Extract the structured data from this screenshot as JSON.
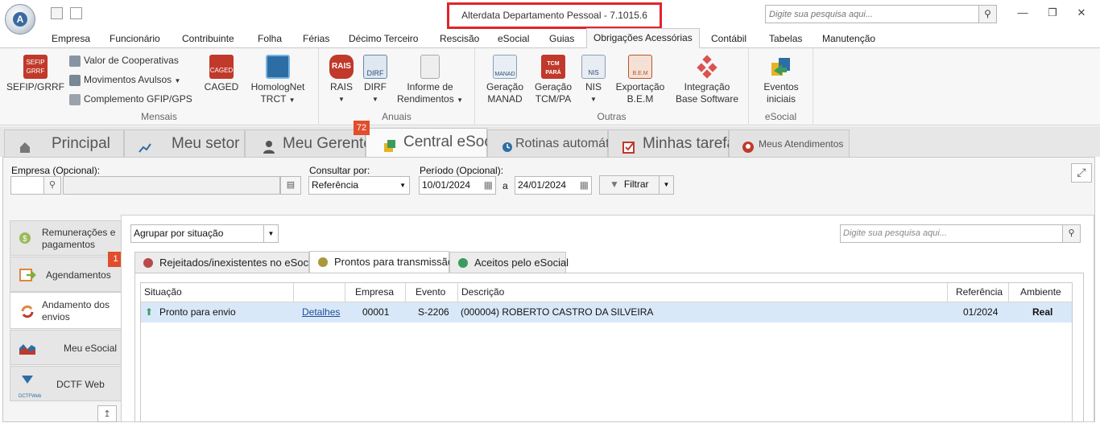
{
  "window": {
    "title": "Alterdata Departamento Pessoal - 7.1015.6",
    "search_placeholder": "Digite sua pesquisa aqui...",
    "app_letter": "A"
  },
  "menu": {
    "items": [
      "Empresa",
      "Funcionário",
      "Contribuinte",
      "Folha",
      "Férias",
      "Décimo Terceiro",
      "Rescisão",
      "eSocial",
      "Guias",
      "Obrigações Acessórias",
      "Contábil",
      "Tabelas",
      "Manutenção"
    ],
    "active": "Obrigações Acessórias"
  },
  "ribbon": {
    "mensais": {
      "label": "Mensais",
      "sefip": "SEFIP/GRRF",
      "sefip_icon_text": "SEFIP GRRF",
      "valor_coop": "Valor de Cooperativas",
      "mov_avulsos": "Movimentos Avulsos",
      "complemento": "Complemento GFIP/GPS",
      "caged": "CAGED",
      "caged_icon_text": "CAGED",
      "homolognet_line1": "HomologNet",
      "homolognet_line2": "TRCT"
    },
    "anuais": {
      "label": "Anuais",
      "rais": "RAIS",
      "rais_icon_text": "RAIS",
      "dirf": "DIRF",
      "dirf_icon_text": "DIRF",
      "informe_line1": "Informe de",
      "informe_line2": "Rendimentos"
    },
    "outras": {
      "label": "Outras",
      "manad_line1": "Geração",
      "manad_line2": "MANAD",
      "manad_icon_text": "MANAD",
      "tcm_line1": "Geração",
      "tcm_line2": "TCM/PA",
      "tcm_icon_text": "TCM PARÁ",
      "nis": "NIS",
      "nis_icon_text": "NIS",
      "bem_line1": "Exportação",
      "bem_line2": "B.E.M",
      "bem_icon_text": "B.E.M",
      "integracao_line1": "Integração",
      "integracao_line2": "Base Software"
    },
    "esocial": {
      "label": "eSocial",
      "eventos_line1": "Eventos",
      "eventos_line2": "iniciais"
    }
  },
  "tabs": [
    {
      "label": "Principal",
      "icon": "home-icon"
    },
    {
      "label": "Meu setor",
      "icon": "chart-icon"
    },
    {
      "label": "Meu Gerente",
      "icon": "person-icon"
    },
    {
      "label": "Central eSocial",
      "icon": "esocial-icon"
    },
    {
      "label": "Rotinas automáticas",
      "icon": "clock-icon"
    },
    {
      "label": "Minhas tarefas",
      "icon": "checkbox-icon"
    },
    {
      "label": "Meus Atendimentos",
      "icon": "support-icon"
    }
  ],
  "tab_badge": "72",
  "filters": {
    "empresa_label": "Empresa (Opcional):",
    "consultar_label": "Consultar por:",
    "consultar_value": "Referência",
    "periodo_label": "Período (Opcional):",
    "date_from": "10/01/2024",
    "date_sep": "a",
    "date_to": "24/01/2024",
    "filtrar": "Filtrar"
  },
  "left_nav": [
    {
      "line1": "Remunerações e",
      "line2": "pagamentos",
      "icon": "money-icon"
    },
    {
      "line1": "Agendamentos",
      "line2": "",
      "icon": "calendar-arrow-icon"
    },
    {
      "line1": "Andamento dos",
      "line2": "envios",
      "icon": "refresh-icon"
    },
    {
      "line1": "Meu eSocial",
      "line2": "",
      "icon": "area-chart-icon"
    },
    {
      "line1": "DCTF Web",
      "line2": "",
      "icon": "dctf-web-icon"
    }
  ],
  "nav_badge": "1",
  "nav_dctf_icon_text": "DCTFWeb",
  "group_by": "Agrupar por situação",
  "panel_search_placeholder": "Digite sua pesquisa aqui...",
  "status_tabs": [
    {
      "label": "Rejeitados/inexistentes no eSocial",
      "color": "#b94a4a"
    },
    {
      "label": "Prontos para transmissão",
      "color": "#a9993c"
    },
    {
      "label": "Aceitos pelo eSocial",
      "color": "#3d9a5e"
    }
  ],
  "grid": {
    "headers": [
      "Situação",
      "",
      "Empresa",
      "Evento",
      "Descrição",
      "Referência",
      "Ambiente"
    ],
    "rows": [
      {
        "situacao": "Pronto para envio",
        "detalhes": "Detalhes",
        "empresa": "00001",
        "evento": "S-2206",
        "descricao": "(000004) ROBERTO CASTRO DA SILVEIRA",
        "referencia": "01/2024",
        "ambiente": "Real"
      }
    ]
  }
}
